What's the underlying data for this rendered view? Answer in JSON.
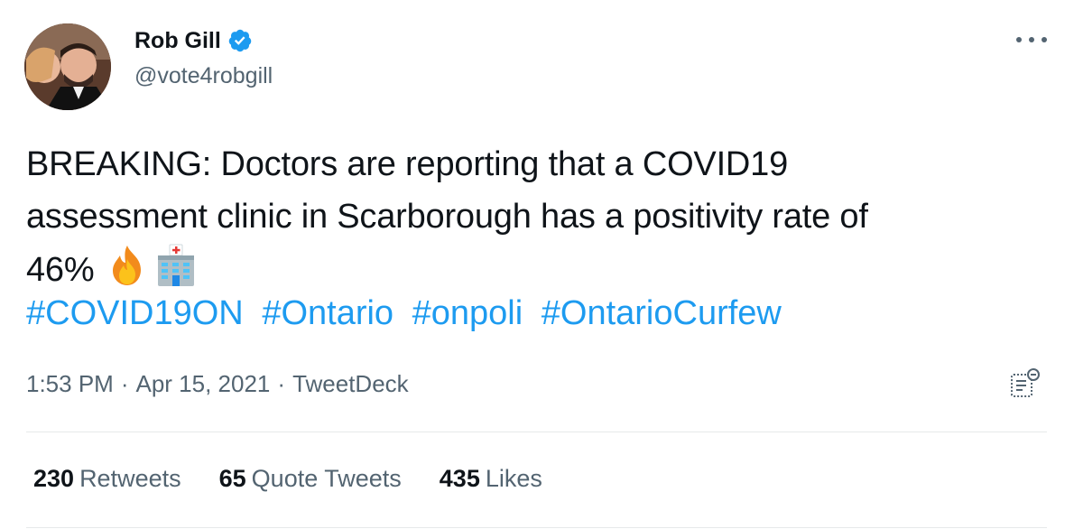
{
  "author": {
    "display_name": "Rob Gill",
    "handle": "@vote4robgill",
    "verified": true
  },
  "tweet": {
    "text_lines": [
      "BREAKING: Doctors are reporting that a COVID19",
      "assessment clinic in Scarborough has a positivity rate of",
      "46%"
    ],
    "emojis": [
      "fire-emoji",
      "hospital-emoji"
    ],
    "hashtags": [
      "#COVID19ON",
      "#Ontario",
      "#onpoli",
      "#OntarioCurfew"
    ]
  },
  "meta": {
    "time": "1:53 PM",
    "separator": "·",
    "date": "Apr 15, 2021",
    "source": "TweetDeck"
  },
  "stats": {
    "retweets_count": "230",
    "retweets_label": "Retweets",
    "quotes_count": "65",
    "quotes_label": "Quote Tweets",
    "likes_count": "435",
    "likes_label": "Likes"
  },
  "colors": {
    "link": "#1d9bf0",
    "secondary_text": "#536471",
    "primary_text": "#0f1419",
    "verified": "#1d9bf0"
  },
  "icons": {
    "more": "more-icon",
    "verified": "verified-badge-icon",
    "analytics": "analytics-icon"
  }
}
